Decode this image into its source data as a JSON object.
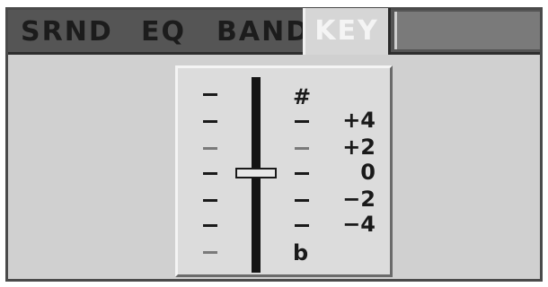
{
  "tabs": [
    {
      "label": "SRND"
    },
    {
      "label": "EQ"
    },
    {
      "label": "BAND"
    },
    {
      "label": "KEY",
      "active": true
    }
  ],
  "key_panel": {
    "sharp_symbol": "#",
    "flat_symbol": "b",
    "scale_labels": [
      "+4",
      "+2",
      "0",
      "−2",
      "−4"
    ],
    "current_value": 0
  },
  "colors": {
    "active_tab_bg": "#d6d6d6",
    "tabbar_bg": "#555555",
    "panel_bg": "#dcdcdc"
  }
}
